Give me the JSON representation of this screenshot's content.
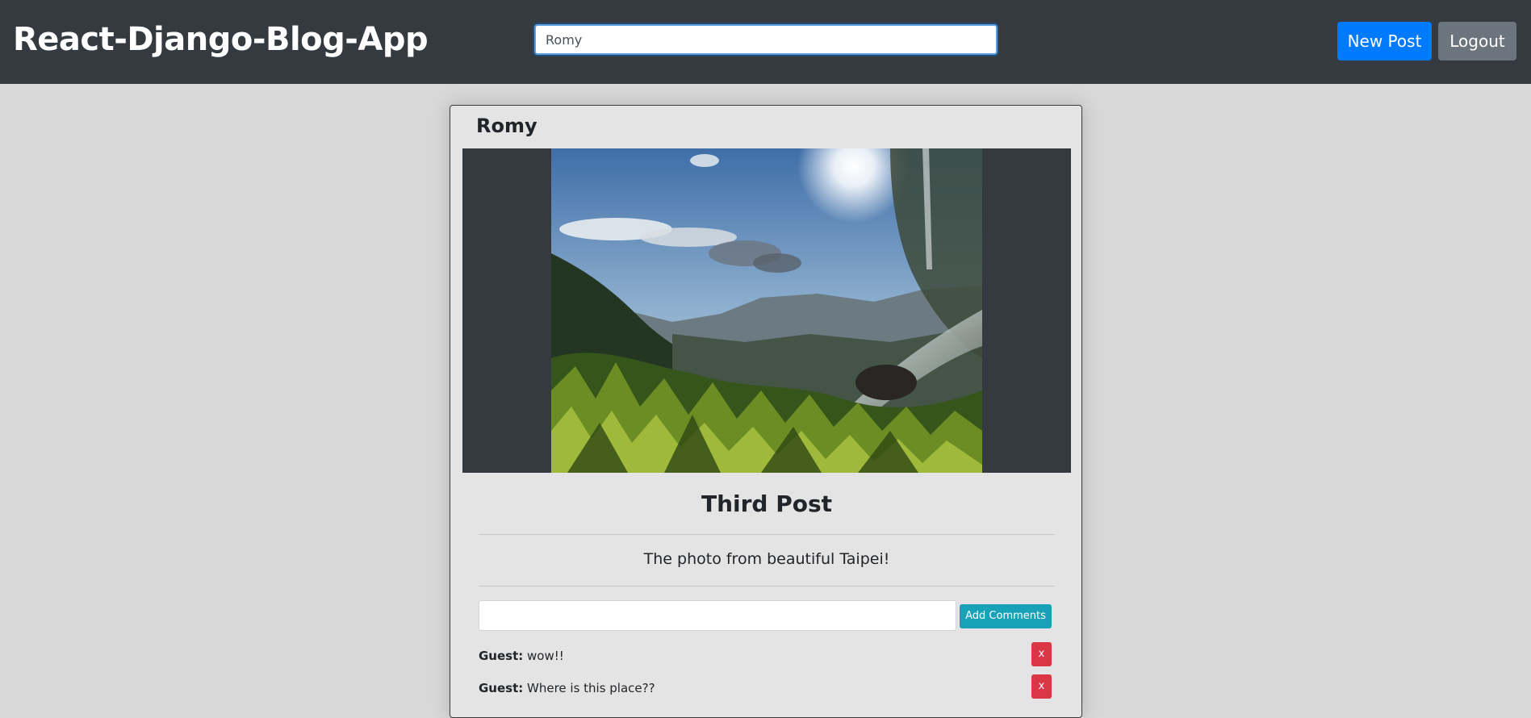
{
  "header": {
    "brand": "React-Django-Blog-App",
    "search_value": "Romy",
    "new_post_label": "New Post",
    "logout_label": "Logout"
  },
  "post": {
    "author": "Romy",
    "image_description": "Taipei mountain valley with waterfall spray",
    "title": "Third Post",
    "body": "The photo from beautiful Taipei!",
    "add_comment_label": "Add Comments",
    "comment_input_value": "",
    "comments": [
      {
        "author": "Guest:",
        "text": "wow!!",
        "delete_label": "x"
      },
      {
        "author": "Guest:",
        "text": "Where is this place??",
        "delete_label": "x"
      }
    ]
  },
  "colors": {
    "navbar": "#343a40",
    "primary": "#007bff",
    "secondary": "#6c757d",
    "info": "#17a2b8",
    "danger": "#dc3545",
    "page_background": "#d9d8d9"
  }
}
